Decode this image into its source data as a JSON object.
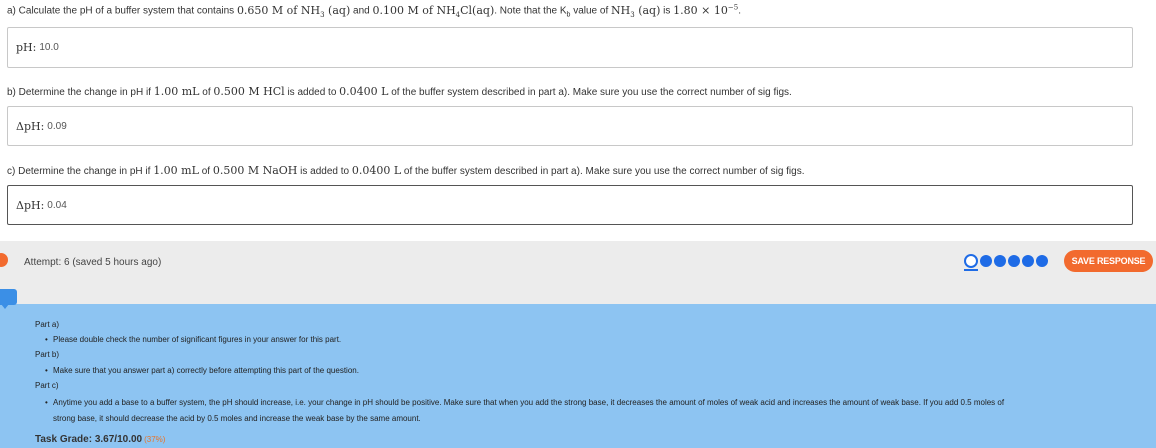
{
  "parts": {
    "a": {
      "question_pre": "a) Calculate the pH of a buffer system that contains ",
      "conc1": "0.650 M of NH",
      "conc1_sub": "3",
      "conc1_post": " (aq)",
      "mid1": " and ",
      "conc2": "0.100 M of NH",
      "conc2_sub": "4",
      "conc2_post": "Cl(aq)",
      "mid2": ". Note that the K",
      "kb_sub": "b",
      "mid3": " value of ",
      "species": "NH",
      "species_sub": "3",
      "species_post": " (aq)",
      "mid4": " is ",
      "kb_value": "1.80 × 10",
      "kb_exp": "−5",
      "end": ".",
      "answer_label": "pH:",
      "answer_value": "10.0"
    },
    "b": {
      "question_pre": "b) Determine the change in pH if ",
      "vol": "1.00 mL",
      "mid1": " of ",
      "reagent": "0.500 M HCl",
      "mid2": " is added to ",
      "buffer_vol": "0.0400 L",
      "end": " of the buffer system described in part a). Make sure you use the correct number of sig figs.",
      "answer_label": "ΔpH:",
      "answer_value": "0.09"
    },
    "c": {
      "question_pre": "c) Determine the change in pH if ",
      "vol": "1.00 mL",
      "mid1": " of ",
      "reagent": "0.500 M NaOH",
      "mid2": " is added to ",
      "buffer_vol": "0.0400 L",
      "end": " of the buffer system described in part a). Make sure you use the correct number of sig figs.",
      "answer_label": "ΔpH:",
      "answer_value": "0.04"
    }
  },
  "status": {
    "attempt": "Attempt: 6 (saved 5 hours ago)",
    "save_label": "SAVE RESPONSE",
    "dot_count": 6
  },
  "feedback": {
    "part_a_title": "Part a)",
    "part_a_text": "Please double check the number of significant figures in your answer for this part.",
    "part_b_title": "Part b)",
    "part_b_text": "Make sure that you answer part a) correctly before attempting this part of the question.",
    "part_c_title": "Part c)",
    "part_c_text_1": "Anytime you add a base to a buffer system, the pH should increase, i.e. your change in pH should be positive. Make sure that when you add the strong base, it decreases the amount of moles of weak acid and increases the amount of weak base. If you add 0.5 moles of",
    "part_c_text_2": "strong base, it should decrease the acid by 0.5 moles and increase the weak base by the same amount.",
    "grade_label": "Task Grade: 3.67/10.00",
    "grade_pct": "(37%)"
  },
  "colors": {
    "accent_orange": "#f26a2e",
    "dot_blue": "#1e6be6",
    "feedback_bg": "#8dc4f2"
  }
}
